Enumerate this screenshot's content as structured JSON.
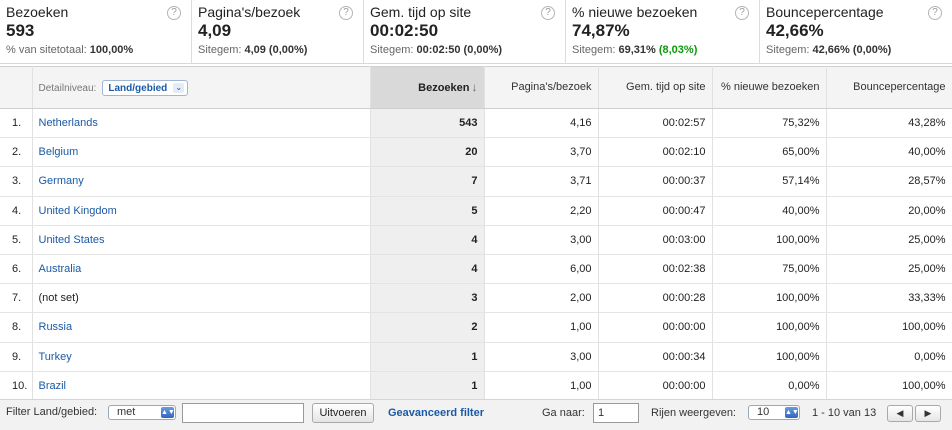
{
  "scorecards": [
    {
      "label": "Bezoeken",
      "value": "593",
      "sub_prefix": "% van sitetotaal: ",
      "sub_value": "100,00%",
      "sub_delta": ""
    },
    {
      "label": "Pagina's/bezoek",
      "value": "4,09",
      "sub_prefix": "Sitegem: ",
      "sub_value": "4,09 (0,00%)",
      "sub_delta": ""
    },
    {
      "label": "Gem. tijd op site",
      "value": "00:02:50",
      "sub_prefix": "Sitegem: ",
      "sub_value": "00:02:50 (0,00%)",
      "sub_delta": ""
    },
    {
      "label": "% nieuwe bezoeken",
      "value": "74,87%",
      "sub_prefix": "Sitegem: ",
      "sub_value": "69,31% ",
      "sub_delta": "(8,03%)"
    },
    {
      "label": "Bouncepercentage",
      "value": "42,66%",
      "sub_prefix": "Sitegem: ",
      "sub_value": "42,66% (0,00%)",
      "sub_delta": ""
    }
  ],
  "help_glyph": "?",
  "table": {
    "detail_label": "Detailniveau:",
    "dimension_select": "Land/gebied",
    "columns": [
      "Bezoeken",
      "Pagina's/bezoek",
      "Gem. tijd op site",
      "% nieuwe bezoeken",
      "Bouncepercentage"
    ],
    "sort_arrow": "↓",
    "rows": [
      {
        "index": "1.",
        "country": "Netherlands",
        "link": true,
        "visits": "543",
        "pages": "4,16",
        "time": "00:02:57",
        "new": "75,32%",
        "bounce": "43,28%"
      },
      {
        "index": "2.",
        "country": "Belgium",
        "link": true,
        "visits": "20",
        "pages": "3,70",
        "time": "00:02:10",
        "new": "65,00%",
        "bounce": "40,00%"
      },
      {
        "index": "3.",
        "country": "Germany",
        "link": true,
        "visits": "7",
        "pages": "3,71",
        "time": "00:00:37",
        "new": "57,14%",
        "bounce": "28,57%"
      },
      {
        "index": "4.",
        "country": "United Kingdom",
        "link": true,
        "visits": "5",
        "pages": "2,20",
        "time": "00:00:47",
        "new": "40,00%",
        "bounce": "20,00%"
      },
      {
        "index": "5.",
        "country": "United States",
        "link": true,
        "visits": "4",
        "pages": "3,00",
        "time": "00:03:00",
        "new": "100,00%",
        "bounce": "25,00%"
      },
      {
        "index": "6.",
        "country": "Australia",
        "link": true,
        "visits": "4",
        "pages": "6,00",
        "time": "00:02:38",
        "new": "75,00%",
        "bounce": "25,00%"
      },
      {
        "index": "7.",
        "country": "(not set)",
        "link": false,
        "visits": "3",
        "pages": "2,00",
        "time": "00:00:28",
        "new": "100,00%",
        "bounce": "33,33%"
      },
      {
        "index": "8.",
        "country": "Russia",
        "link": true,
        "visits": "2",
        "pages": "1,00",
        "time": "00:00:00",
        "new": "100,00%",
        "bounce": "100,00%"
      },
      {
        "index": "9.",
        "country": "Turkey",
        "link": true,
        "visits": "1",
        "pages": "3,00",
        "time": "00:00:34",
        "new": "100,00%",
        "bounce": "0,00%"
      },
      {
        "index": "10.",
        "country": "Brazil",
        "link": true,
        "visits": "1",
        "pages": "1,00",
        "time": "00:00:00",
        "new": "0,00%",
        "bounce": "100,00%"
      }
    ]
  },
  "footer": {
    "filter_label": "Filter Land/gebied:",
    "filter_operator": "met",
    "filter_value": "",
    "apply_button": "Uitvoeren",
    "advanced_filter": "Geavanceerd filter",
    "goto_label": "Ga naar:",
    "goto_value": "1",
    "rows_label": "Rijen weergeven:",
    "rows_value": "10",
    "range_text": "1 - 10 van 13",
    "prev_glyph": "◀",
    "next_glyph": "▶",
    "select_arrow_glyph": "▲▼"
  },
  "colors": {
    "link": "#1a5aa6",
    "positive": "#0a9a0a",
    "sorted_header": "#d9d9d9"
  }
}
